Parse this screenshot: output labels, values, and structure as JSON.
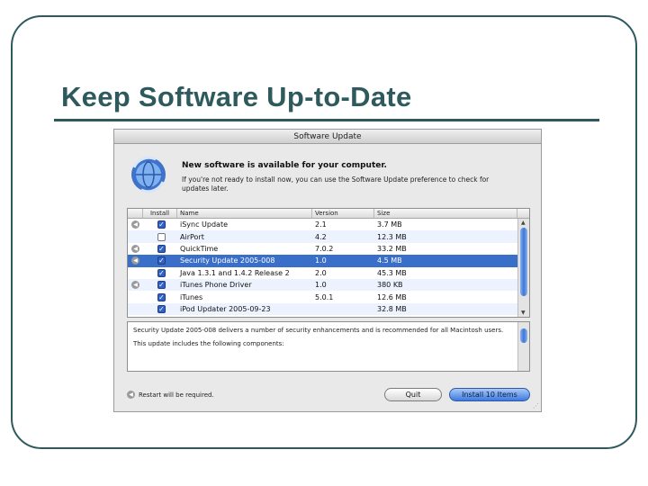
{
  "slide": {
    "title": "Keep Software Up-to-Date"
  },
  "window": {
    "title": "Software Update",
    "header": {
      "title": "New software is available for your computer.",
      "description": "If you're not ready to install now, you can use the Software Update preference to check for updates later."
    },
    "table": {
      "columns": {
        "install": "Install",
        "name": "Name",
        "version": "Version",
        "size": "Size"
      },
      "rows": [
        {
          "name": "iSync Update",
          "version": "2.1",
          "size": "3.7 MB",
          "installed": true,
          "restart": true,
          "selected": false
        },
        {
          "name": "AirPort",
          "version": "4.2",
          "size": "12.3 MB",
          "installed": false,
          "restart": false,
          "selected": false
        },
        {
          "name": "QuickTime",
          "version": "7.0.2",
          "size": "33.2 MB",
          "installed": true,
          "restart": true,
          "selected": false
        },
        {
          "name": "Security Update 2005-008",
          "version": "1.0",
          "size": "4.5 MB",
          "installed": true,
          "restart": true,
          "selected": true
        },
        {
          "name": "Java 1.3.1 and 1.4.2 Release 2",
          "version": "2.0",
          "size": "45.3 MB",
          "installed": true,
          "restart": false,
          "selected": false
        },
        {
          "name": "iTunes Phone Driver",
          "version": "1.0",
          "size": "380 KB",
          "installed": true,
          "restart": true,
          "selected": false
        },
        {
          "name": "iTunes",
          "version": "5.0.1",
          "size": "12.6 MB",
          "installed": true,
          "restart": false,
          "selected": false
        },
        {
          "name": "iPod Updater 2005-09-23",
          "version": "",
          "size": "32.8 MB",
          "installed": true,
          "restart": false,
          "selected": false
        }
      ]
    },
    "detail": {
      "line1": "Security Update 2005-008 delivers a number of security enhancements and is recommended for all Macintosh users.",
      "line2": "This update includes the following components:"
    },
    "restart_note": "Restart will be required.",
    "buttons": {
      "quit": "Quit",
      "install": "Install 10 Items"
    }
  },
  "icons": {
    "restart": "restart-icon",
    "app": "software-update-globe-icon",
    "checkbox": "checkbox-icon"
  },
  "colors": {
    "theme": "#2e5a5e",
    "selection": "#3a6fc9"
  }
}
